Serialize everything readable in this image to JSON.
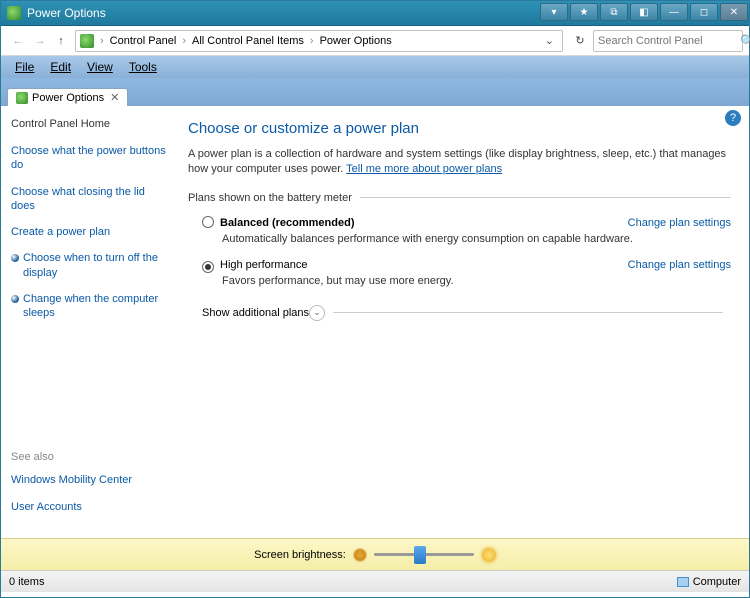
{
  "window": {
    "title": "Power Options"
  },
  "breadcrumb": {
    "items": [
      "Control Panel",
      "All Control Panel Items",
      "Power Options"
    ]
  },
  "search": {
    "placeholder": "Search Control Panel"
  },
  "menus": [
    "File",
    "Edit",
    "View",
    "Tools"
  ],
  "tab": {
    "title": "Power Options"
  },
  "sidebar": {
    "home": "Control Panel Home",
    "links": [
      "Choose what the power buttons do",
      "Choose what closing the lid does",
      "Create a power plan",
      "Choose when to turn off the display",
      "Change when the computer sleeps"
    ],
    "see_also_label": "See also",
    "see_also": [
      "Windows Mobility Center",
      "User Accounts"
    ]
  },
  "main": {
    "heading": "Choose or customize a power plan",
    "desc_prefix": "A power plan is a collection of hardware and system settings (like display brightness, sleep, etc.) that manages how your computer uses power. ",
    "desc_link": "Tell me more about power plans",
    "section_title": "Plans shown on the battery meter",
    "plans": [
      {
        "name": "Balanced (recommended)",
        "selected": false,
        "bold": true,
        "desc": "Automatically balances performance with energy consumption on capable hardware.",
        "change": "Change plan settings"
      },
      {
        "name": "High performance",
        "selected": true,
        "bold": false,
        "desc": "Favors performance, but may use more energy.",
        "change": "Change plan settings"
      }
    ],
    "show_additional": "Show additional plans"
  },
  "brightness": {
    "label": "Screen brightness:"
  },
  "statusbar": {
    "items": "0 items",
    "location": "Computer"
  }
}
